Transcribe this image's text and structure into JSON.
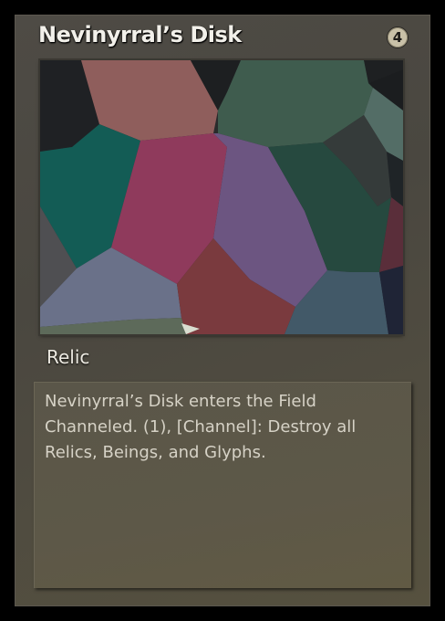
{
  "card": {
    "title": "Nevinyrral’s Disk",
    "cost": "4",
    "type": "Relic",
    "rules_text": "Nevinyrral’s Disk enters the Field Channeled. (1), [Channel]: Destroy all Relics, Beings, and Glyphs.",
    "art_icon": "voronoi-mosaic-artwork",
    "colors": {
      "frame": "#4e4b45",
      "textbox": "#5d5848",
      "title_text": "#f2f0ea",
      "rules_text": "#d6d2c6"
    }
  }
}
